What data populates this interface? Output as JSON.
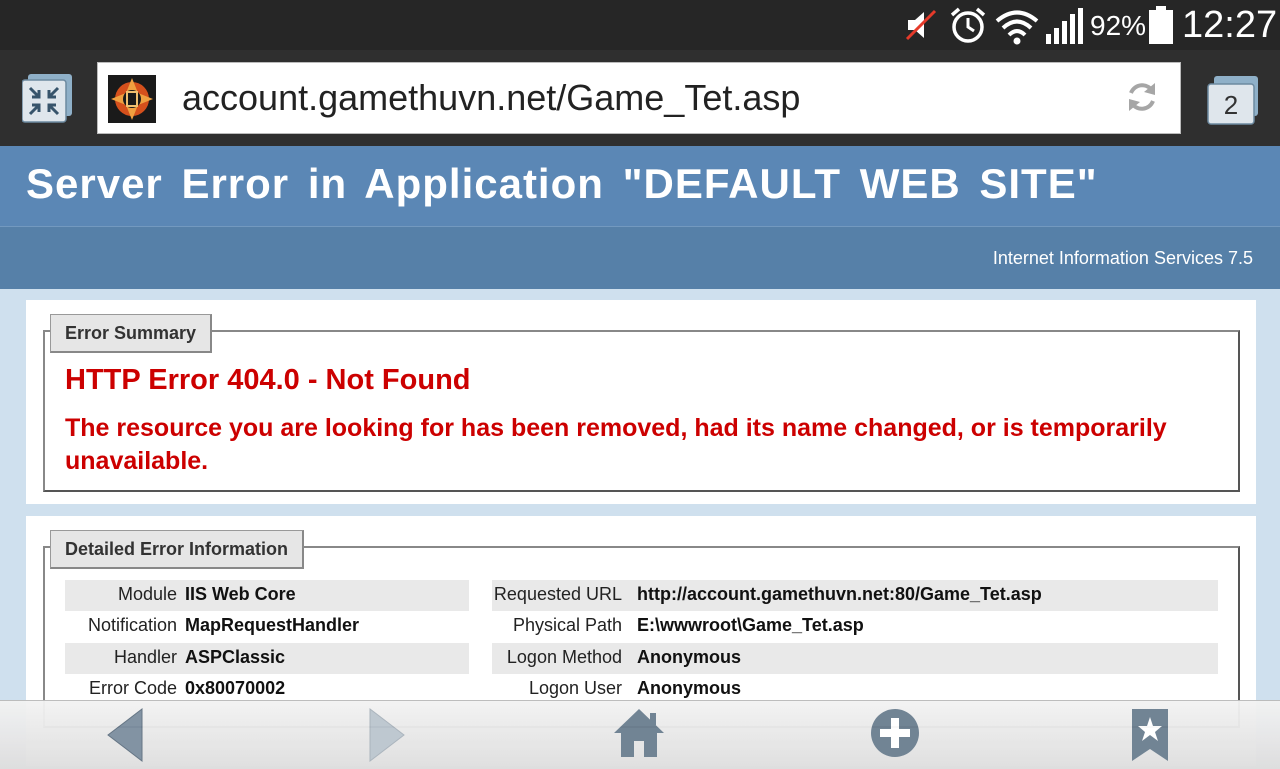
{
  "status_bar": {
    "battery_percent": "92%",
    "time": "12:27",
    "icons": [
      "mute-icon",
      "alarm-icon",
      "wifi-icon",
      "signal-icon",
      "battery-icon"
    ]
  },
  "browser": {
    "url": "account.gamethuvn.net/Game_Tet.asp",
    "tab_count": "2"
  },
  "header": {
    "title": "Server Error in Application \"DEFAULT WEB SITE\"",
    "version": "Internet Information Services 7.5"
  },
  "error_summary": {
    "legend": "Error Summary",
    "title": "HTTP Error 404.0 - Not Found",
    "description": "The resource you are looking for has been removed, had its name changed, or is temporarily unavailable."
  },
  "detailed": {
    "legend": "Detailed Error Information",
    "left": [
      {
        "label": "Module",
        "value": "IIS Web Core"
      },
      {
        "label": "Notification",
        "value": "MapRequestHandler"
      },
      {
        "label": "Handler",
        "value": "ASPClassic"
      },
      {
        "label": "Error Code",
        "value": "0x80070002"
      }
    ],
    "right": [
      {
        "label": "Requested URL",
        "value": "http://account.gamethuvn.net:80/Game_Tet.asp"
      },
      {
        "label": "Physical Path",
        "value": "E:\\wwwroot\\Game_Tet.asp"
      },
      {
        "label": "Logon Method",
        "value": "Anonymous"
      },
      {
        "label": "Logon User",
        "value": "Anonymous"
      }
    ]
  },
  "colors": {
    "header_blue": "#5b87b5",
    "error_red": "#cc0000"
  }
}
